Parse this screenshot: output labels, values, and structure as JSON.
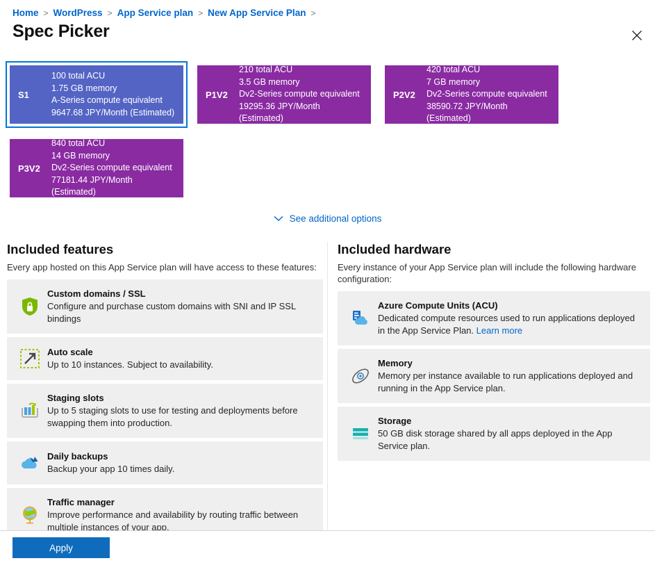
{
  "breadcrumb": {
    "items": [
      "Home",
      "WordPress",
      "App Service plan",
      "New App Service Plan"
    ],
    "separator": ">"
  },
  "header": {
    "title": "Spec Picker",
    "close_label": "Close",
    "close_icon": "close-icon"
  },
  "specs": {
    "cards": [
      {
        "sku": "S1",
        "acu": "100 total ACU",
        "memory": "1.75 GB memory",
        "compute": "A-Series compute equivalent",
        "price": "9647.68 JPY/Month (Estimated)",
        "selected": true,
        "color": "#5464c4"
      },
      {
        "sku": "P1V2",
        "acu": "210 total ACU",
        "memory": "3.5 GB memory",
        "compute": "Dv2-Series compute equivalent",
        "price": "19295.36 JPY/Month (Estimated)",
        "selected": false,
        "color": "#8a2ba2"
      },
      {
        "sku": "P2V2",
        "acu": "420 total ACU",
        "memory": "7 GB memory",
        "compute": "Dv2-Series compute equivalent",
        "price": "38590.72 JPY/Month (Estimated)",
        "selected": false,
        "color": "#8a2ba2"
      },
      {
        "sku": "P3V2",
        "acu": "840 total ACU",
        "memory": "14 GB memory",
        "compute": "Dv2-Series compute equivalent",
        "price": "77181.44 JPY/Month (Estimated)",
        "selected": false,
        "color": "#8a2ba2"
      }
    ],
    "more_options_label": "See additional options",
    "more_options_icon": "chevron-down-icon"
  },
  "features": {
    "heading": "Included features",
    "intro": "Every app hosted on this App Service plan will have access to these features:",
    "items": [
      {
        "icon": "shield-lock-icon",
        "title": "Custom domains / SSL",
        "desc": "Configure and purchase custom domains with SNI and IP SSL bindings"
      },
      {
        "icon": "auto-scale-icon",
        "title": "Auto scale",
        "desc": "Up to 10 instances. Subject to availability."
      },
      {
        "icon": "staging-slots-icon",
        "title": "Staging slots",
        "desc": "Up to 5 staging slots to use for testing and deployments before swapping them into production."
      },
      {
        "icon": "cloud-backup-icon",
        "title": "Daily backups",
        "desc": "Backup your app 10 times daily."
      },
      {
        "icon": "globe-icon",
        "title": "Traffic manager",
        "desc": "Improve performance and availability by routing traffic between multiple instances of your app."
      }
    ]
  },
  "hardware": {
    "heading": "Included hardware",
    "intro": "Every instance of your App Service plan will include the following hardware configuration:",
    "items": [
      {
        "icon": "compute-cloud-icon",
        "title": "Azure Compute Units (ACU)",
        "desc": "Dedicated compute resources used to run applications deployed in the App Service Plan.",
        "link_label": "Learn more"
      },
      {
        "icon": "memory-orbit-icon",
        "title": "Memory",
        "desc": "Memory per instance available to run applications deployed and running in the App Service plan.",
        "link_label": ""
      },
      {
        "icon": "storage-disk-icon",
        "title": "Storage",
        "desc": "50 GB disk storage shared by all apps deployed in the App Service plan.",
        "link_label": ""
      }
    ]
  },
  "footer": {
    "apply_label": "Apply"
  },
  "colors": {
    "link": "#0066cc",
    "selected_border": "#0078d4",
    "card_purple": "#8a2ba2",
    "card_selected": "#5464c4",
    "apply_button": "#0f6cbd",
    "tile_bg": "#efefef"
  }
}
